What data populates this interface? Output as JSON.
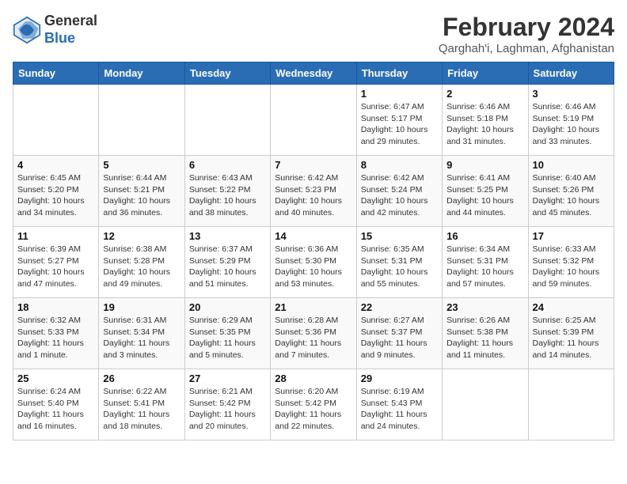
{
  "logo": {
    "line1": "General",
    "line2": "Blue"
  },
  "title": "February 2024",
  "subtitle": "Qarghah'i, Laghman, Afghanistan",
  "days_of_week": [
    "Sunday",
    "Monday",
    "Tuesday",
    "Wednesday",
    "Thursday",
    "Friday",
    "Saturday"
  ],
  "weeks": [
    [
      {
        "day": "",
        "info": ""
      },
      {
        "day": "",
        "info": ""
      },
      {
        "day": "",
        "info": ""
      },
      {
        "day": "",
        "info": ""
      },
      {
        "day": "1",
        "info": "Sunrise: 6:47 AM\nSunset: 5:17 PM\nDaylight: 10 hours\nand 29 minutes."
      },
      {
        "day": "2",
        "info": "Sunrise: 6:46 AM\nSunset: 5:18 PM\nDaylight: 10 hours\nand 31 minutes."
      },
      {
        "day": "3",
        "info": "Sunrise: 6:46 AM\nSunset: 5:19 PM\nDaylight: 10 hours\nand 33 minutes."
      }
    ],
    [
      {
        "day": "4",
        "info": "Sunrise: 6:45 AM\nSunset: 5:20 PM\nDaylight: 10 hours\nand 34 minutes."
      },
      {
        "day": "5",
        "info": "Sunrise: 6:44 AM\nSunset: 5:21 PM\nDaylight: 10 hours\nand 36 minutes."
      },
      {
        "day": "6",
        "info": "Sunrise: 6:43 AM\nSunset: 5:22 PM\nDaylight: 10 hours\nand 38 minutes."
      },
      {
        "day": "7",
        "info": "Sunrise: 6:42 AM\nSunset: 5:23 PM\nDaylight: 10 hours\nand 40 minutes."
      },
      {
        "day": "8",
        "info": "Sunrise: 6:42 AM\nSunset: 5:24 PM\nDaylight: 10 hours\nand 42 minutes."
      },
      {
        "day": "9",
        "info": "Sunrise: 6:41 AM\nSunset: 5:25 PM\nDaylight: 10 hours\nand 44 minutes."
      },
      {
        "day": "10",
        "info": "Sunrise: 6:40 AM\nSunset: 5:26 PM\nDaylight: 10 hours\nand 45 minutes."
      }
    ],
    [
      {
        "day": "11",
        "info": "Sunrise: 6:39 AM\nSunset: 5:27 PM\nDaylight: 10 hours\nand 47 minutes."
      },
      {
        "day": "12",
        "info": "Sunrise: 6:38 AM\nSunset: 5:28 PM\nDaylight: 10 hours\nand 49 minutes."
      },
      {
        "day": "13",
        "info": "Sunrise: 6:37 AM\nSunset: 5:29 PM\nDaylight: 10 hours\nand 51 minutes."
      },
      {
        "day": "14",
        "info": "Sunrise: 6:36 AM\nSunset: 5:30 PM\nDaylight: 10 hours\nand 53 minutes."
      },
      {
        "day": "15",
        "info": "Sunrise: 6:35 AM\nSunset: 5:31 PM\nDaylight: 10 hours\nand 55 minutes."
      },
      {
        "day": "16",
        "info": "Sunrise: 6:34 AM\nSunset: 5:31 PM\nDaylight: 10 hours\nand 57 minutes."
      },
      {
        "day": "17",
        "info": "Sunrise: 6:33 AM\nSunset: 5:32 PM\nDaylight: 10 hours\nand 59 minutes."
      }
    ],
    [
      {
        "day": "18",
        "info": "Sunrise: 6:32 AM\nSunset: 5:33 PM\nDaylight: 11 hours\nand 1 minute."
      },
      {
        "day": "19",
        "info": "Sunrise: 6:31 AM\nSunset: 5:34 PM\nDaylight: 11 hours\nand 3 minutes."
      },
      {
        "day": "20",
        "info": "Sunrise: 6:29 AM\nSunset: 5:35 PM\nDaylight: 11 hours\nand 5 minutes."
      },
      {
        "day": "21",
        "info": "Sunrise: 6:28 AM\nSunset: 5:36 PM\nDaylight: 11 hours\nand 7 minutes."
      },
      {
        "day": "22",
        "info": "Sunrise: 6:27 AM\nSunset: 5:37 PM\nDaylight: 11 hours\nand 9 minutes."
      },
      {
        "day": "23",
        "info": "Sunrise: 6:26 AM\nSunset: 5:38 PM\nDaylight: 11 hours\nand 11 minutes."
      },
      {
        "day": "24",
        "info": "Sunrise: 6:25 AM\nSunset: 5:39 PM\nDaylight: 11 hours\nand 14 minutes."
      }
    ],
    [
      {
        "day": "25",
        "info": "Sunrise: 6:24 AM\nSunset: 5:40 PM\nDaylight: 11 hours\nand 16 minutes."
      },
      {
        "day": "26",
        "info": "Sunrise: 6:22 AM\nSunset: 5:41 PM\nDaylight: 11 hours\nand 18 minutes."
      },
      {
        "day": "27",
        "info": "Sunrise: 6:21 AM\nSunset: 5:42 PM\nDaylight: 11 hours\nand 20 minutes."
      },
      {
        "day": "28",
        "info": "Sunrise: 6:20 AM\nSunset: 5:42 PM\nDaylight: 11 hours\nand 22 minutes."
      },
      {
        "day": "29",
        "info": "Sunrise: 6:19 AM\nSunset: 5:43 PM\nDaylight: 11 hours\nand 24 minutes."
      },
      {
        "day": "",
        "info": ""
      },
      {
        "day": "",
        "info": ""
      }
    ]
  ]
}
